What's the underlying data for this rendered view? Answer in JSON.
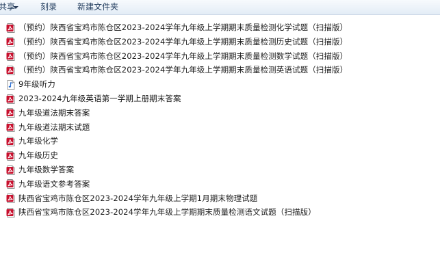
{
  "toolbar": {
    "share_label": "共享",
    "burn_label": "刻录",
    "new_folder_label": "新建文件夹"
  },
  "files": [
    {
      "name": "（预约）陕西省宝鸡市陈仓区2023-2024学年九年级上学期期末质量检测化学试题（扫描版）",
      "icon": "pdf-icon"
    },
    {
      "name": "（预约）陕西省宝鸡市陈仓区2023-2024学年九年级上学期期末质量检测历史试题（扫描版）",
      "icon": "pdf-icon"
    },
    {
      "name": "（预约）陕西省宝鸡市陈仓区2023-2024学年九年级上学期期末质量检测数学试题（扫描版）",
      "icon": "pdf-icon"
    },
    {
      "name": "（预约）陕西省宝鸡市陈仓区2023-2024学年九年级上学期期末质量检测英语试题（扫描版）",
      "icon": "pdf-icon"
    },
    {
      "name": "9年级听力",
      "icon": "audio-file-icon"
    },
    {
      "name": "2023-2024九年级英语第一学期上册期末答案",
      "icon": "pdf-icon"
    },
    {
      "name": "九年级道法期末答案",
      "icon": "pdf-icon"
    },
    {
      "name": "九年级道法期末试题",
      "icon": "pdf-icon"
    },
    {
      "name": "九年级化学",
      "icon": "pdf-icon"
    },
    {
      "name": "九年级历史",
      "icon": "pdf-icon"
    },
    {
      "name": "九年级数学答案",
      "icon": "pdf-icon"
    },
    {
      "name": "九年级语文参考答案",
      "icon": "pdf-icon"
    },
    {
      "name": "陕西省宝鸡市陈仓区2023-2024学年九年级上学期1月期末物理试题",
      "icon": "pdf-icon"
    },
    {
      "name": "陕西省宝鸡市陈仓区2023-2024学年九年级上学期期末质量检测语文试题（扫描版）",
      "icon": "pdf-icon"
    }
  ]
}
